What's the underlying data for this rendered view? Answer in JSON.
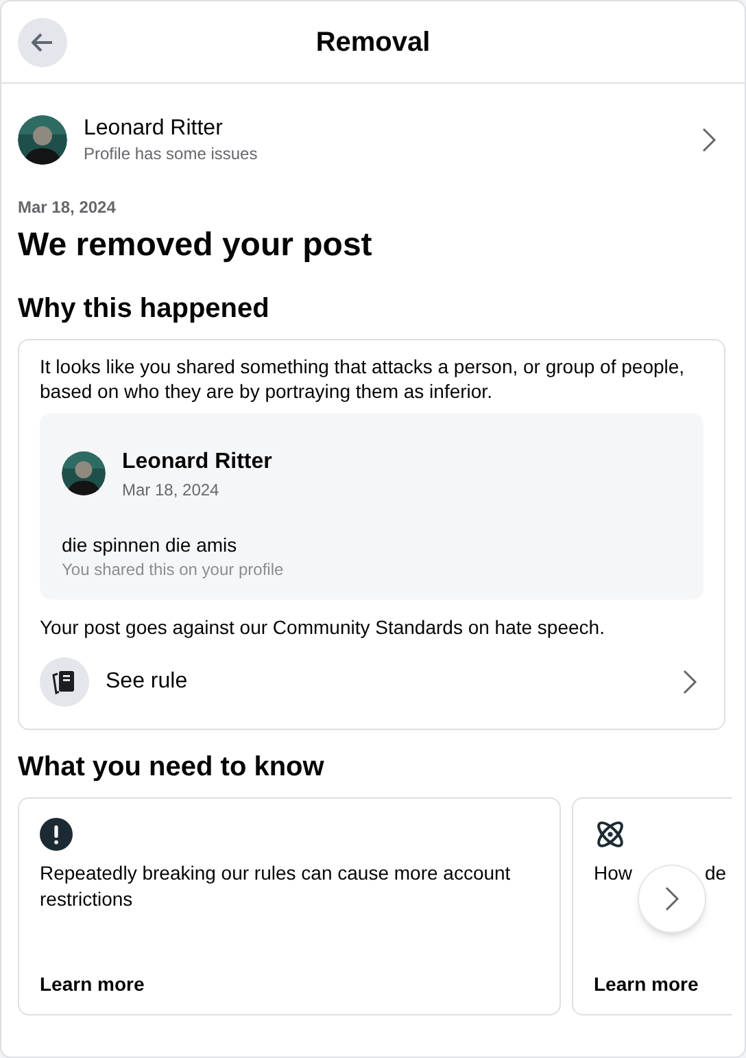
{
  "header": {
    "title": "Removal"
  },
  "profile": {
    "name": "Leonard Ritter",
    "status": "Profile has some issues"
  },
  "date": "Mar 18, 2024",
  "heading": "We removed your post",
  "why": {
    "title": "Why this happened",
    "explanation": "It looks like you shared something that attacks a person, or group of people, based on who they are by portraying them as inferior.",
    "post": {
      "author": "Leonard Ritter",
      "date": "Mar 18, 2024",
      "text": "die spinnen die amis",
      "note": "You shared this on your profile"
    },
    "violation": "Your post goes against our Community Standards on hate speech.",
    "rule_link": "See rule"
  },
  "know": {
    "title": "What you need to know",
    "cards": [
      {
        "kind": "warning",
        "text_parts": [
          "Repeatedly breaking our rules can cause more account restrictions"
        ],
        "link": "Learn more"
      },
      {
        "kind": "atom",
        "text_parts": [
          "How",
          "de"
        ],
        "link": "Learn more"
      }
    ]
  }
}
